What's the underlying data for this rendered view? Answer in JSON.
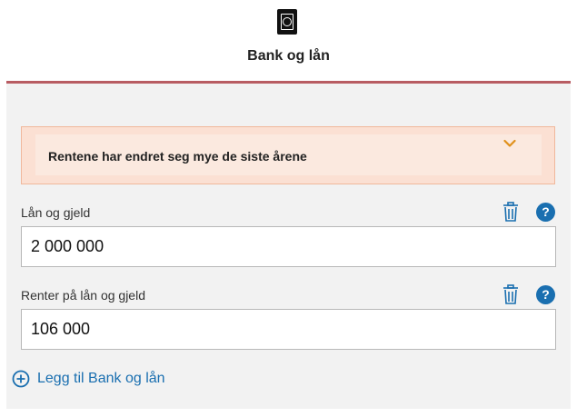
{
  "header": {
    "icon": "safe-icon",
    "title": "Bank og lån",
    "accent_color": "#b85c62"
  },
  "alert": {
    "text": "Rentene har endret seg mye de siste årene",
    "expand_icon": "chevron-down-icon",
    "chevron_color": "#e0901a",
    "background": "#fbe0d3"
  },
  "fields": [
    {
      "label": "Lån og gjeld",
      "value": "2 000 000",
      "delete_icon": "trash-icon",
      "help_label": "?"
    },
    {
      "label": "Renter på lån og gjeld",
      "value": "106 000",
      "delete_icon": "trash-icon",
      "help_label": "?"
    }
  ],
  "add_button": {
    "label": "Legg til Bank og lån",
    "icon": "plus-circle-icon"
  },
  "colors": {
    "link": "#1a6fb0",
    "panel": "#f2f2f2"
  }
}
